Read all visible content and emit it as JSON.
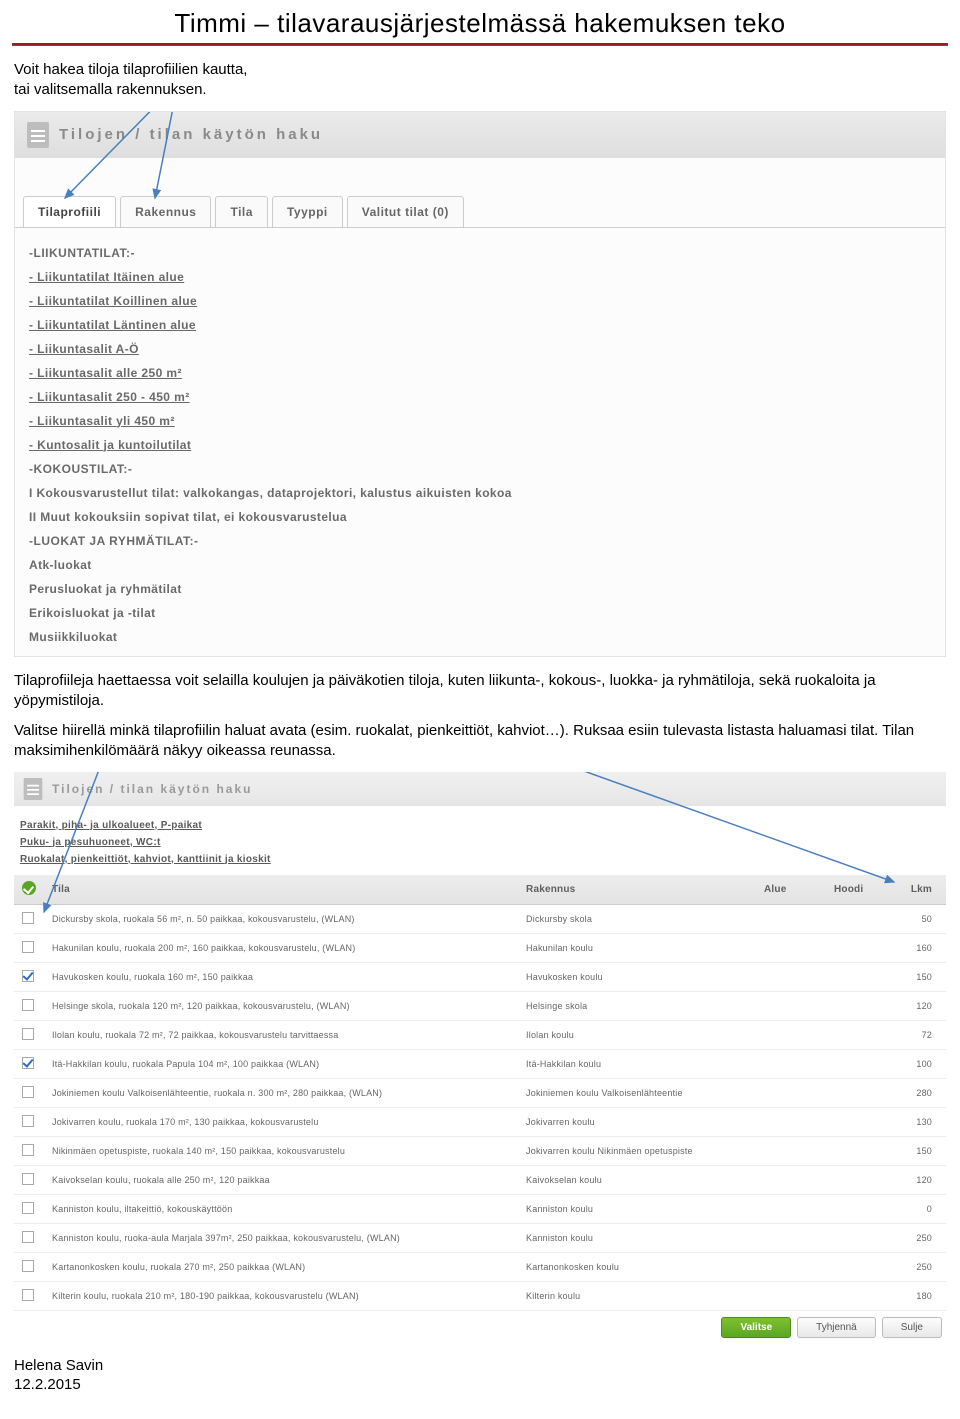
{
  "doc": {
    "title": "Timmi – tilavarausjärjestelmässä hakemuksen teko",
    "intro1": "Voit hakea tiloja tilaprofiilien kautta,",
    "intro2": "tai valitsemalla rakennuksen.",
    "para2": "Tilaprofiileja haettaessa voit selailla koulujen ja päiväkotien tiloja, kuten liikunta-, kokous-, luokka- ja ryhmätiloja, sekä ruokaloita ja yöpymistiloja.",
    "para3": "Valitse hiirellä minkä tilaprofiilin haluat avata (esim. ruokalat, pienkeittiöt, kahviot…). Ruksaa esiin tulevasta listasta haluamasi tilat. Tilan maksimihenkilömäärä näkyy oikeassa reunassa.",
    "footer1": "Helena Savin",
    "footer2": "12.2.2015"
  },
  "shot1": {
    "header": "Tilojen / tilan käytön haku",
    "tabs": [
      "Tilaprofiili",
      "Rakennus",
      "Tila",
      "Tyyppi",
      "Valitut tilat (0)"
    ],
    "items": [
      {
        "type": "grp",
        "text": "-LIIKUNTATILAT:-"
      },
      {
        "type": "lnk",
        "text": "- Liikuntatilat Itäinen alue"
      },
      {
        "type": "lnk",
        "text": "- Liikuntatilat Koillinen alue"
      },
      {
        "type": "lnk",
        "text": "- Liikuntatilat Läntinen alue"
      },
      {
        "type": "lnk",
        "text": "- Liikuntasalit A-Ö"
      },
      {
        "type": "lnk",
        "text": "- Liikuntasalit alle 250 m²"
      },
      {
        "type": "lnk",
        "text": "- Liikuntasalit 250 - 450 m²"
      },
      {
        "type": "lnk",
        "text": "- Liikuntasalit yli 450 m²"
      },
      {
        "type": "lnk",
        "text": "- Kuntosalit ja kuntoilutilat"
      },
      {
        "type": "grp",
        "text": "-KOKOUSTILAT:-"
      },
      {
        "type": "plain",
        "text": "I Kokousvarustellut tilat: valkokangas, dataprojektori, kalustus aikuisten kokoa"
      },
      {
        "type": "plain",
        "text": "II Muut kokouksiin sopivat tilat, ei kokousvarustelua"
      },
      {
        "type": "grp",
        "text": "-LUOKAT JA RYHMÄTILAT:-"
      },
      {
        "type": "lnk",
        "text": "Atk-luokat",
        "nou": true
      },
      {
        "type": "plain",
        "text": "Perusluokat ja ryhmätilat"
      },
      {
        "type": "plain",
        "text": "Erikoisluokat ja -tilat"
      },
      {
        "type": "lnk",
        "text": "Musiikkiluokat",
        "nou": true
      }
    ]
  },
  "shot2": {
    "header": "Tilojen / tilan käytön haku",
    "sublinks": [
      "Parakit, piha- ja ulkoalueet, P-paikat",
      "Puku- ja pesuhuoneet, WC:t",
      "Ruokalat, pienkeittiöt, kahviot, kanttiinit ja kioskit"
    ],
    "cols": {
      "chk": "",
      "tila": "Tila",
      "rak": "Rakennus",
      "alue": "Alue",
      "hoodi": "Hoodi",
      "lkm": "Lkm"
    },
    "rows": [
      {
        "c": false,
        "t": "Dickursby skola, ruokala 56 m², n. 50 paikkaa, kokousvarustelu, (WLAN)",
        "r": "Dickursby skola",
        "l": "50"
      },
      {
        "c": false,
        "t": "Hakunilan koulu, ruokala 200 m², 160 paikkaa, kokousvarustelu, (WLAN)",
        "r": "Hakunilan koulu",
        "l": "160"
      },
      {
        "c": true,
        "t": "Havukosken koulu, ruokala 160 m², 150 paikkaa",
        "r": "Havukosken koulu",
        "l": "150"
      },
      {
        "c": false,
        "t": "Helsinge skola, ruokala 120 m², 120 paikkaa, kokousvarustelu, (WLAN)",
        "r": "Helsinge skola",
        "l": "120"
      },
      {
        "c": false,
        "t": "Ilolan koulu, ruokala 72 m², 72 paikkaa, kokousvarustelu tarvittaessa",
        "r": "Ilolan koulu",
        "l": "72"
      },
      {
        "c": true,
        "t": "Itä-Hakkilan koulu, ruokala Papula 104 m², 100 paikkaa (WLAN)",
        "r": "Itä-Hakkilan koulu",
        "l": "100"
      },
      {
        "c": false,
        "t": "Jokiniemen koulu Valkoisenlähteentie, ruokala n. 300 m², 280 paikkaa, (WLAN)",
        "r": "Jokiniemen koulu Valkoisenlähteentie",
        "l": "280"
      },
      {
        "c": false,
        "t": "Jokivarren koulu, ruokala 170 m², 130 paikkaa, kokousvarustelu",
        "r": "Jokivarren koulu",
        "l": "130"
      },
      {
        "c": false,
        "t": "Nikinmäen opetuspiste, ruokala 140 m², 150 paikkaa, kokousvarustelu",
        "r": "Jokivarren koulu Nikinmäen opetuspiste",
        "l": "150"
      },
      {
        "c": false,
        "t": "Kaivokselan koulu, ruokala alle 250 m², 120 paikkaa",
        "r": "Kaivokselan koulu",
        "l": "120"
      },
      {
        "c": false,
        "t": "Kanniston koulu, iltakeittiö, kokouskäyttöön",
        "r": "Kanniston koulu",
        "l": "0"
      },
      {
        "c": false,
        "t": "Kanniston koulu, ruoka-aula Marjala 397m², 250 paikkaa, kokousvarustelu, (WLAN)",
        "r": "Kanniston koulu",
        "l": "250"
      },
      {
        "c": false,
        "t": "Kartanonkosken koulu, ruokala 270 m², 250 paikkaa (WLAN)",
        "r": "Kartanonkosken koulu",
        "l": "250"
      },
      {
        "c": false,
        "t": "Kilterin koulu, ruokala 210 m², 180-190 paikkaa, kokousvarustelu (WLAN)",
        "r": "Kilterin koulu",
        "l": "180"
      }
    ],
    "buttons": {
      "valitse": "Valitse",
      "tyhjenna": "Tyhjennä",
      "sulje": "Sulje"
    }
  }
}
